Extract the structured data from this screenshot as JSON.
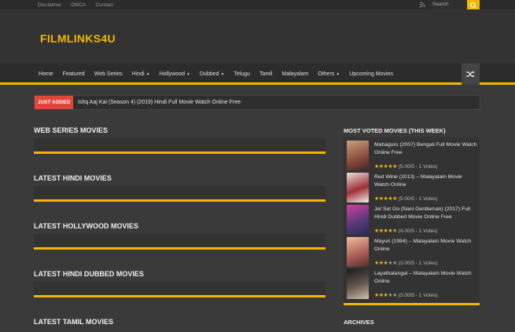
{
  "topbar": {
    "links": [
      "Disclaimer",
      "DMCA",
      "Contact"
    ],
    "search_placeholder": "Search"
  },
  "site": {
    "logo": "FILMLINKS4U"
  },
  "nav": {
    "items": [
      {
        "label": "Home",
        "dropdown": false
      },
      {
        "label": "Featured",
        "dropdown": false
      },
      {
        "label": "Web Series",
        "dropdown": false
      },
      {
        "label": "Hindi",
        "dropdown": true
      },
      {
        "label": "Hollywood",
        "dropdown": true
      },
      {
        "label": "Dubbed",
        "dropdown": true
      },
      {
        "label": "Telugu",
        "dropdown": false
      },
      {
        "label": "Tamil",
        "dropdown": false
      },
      {
        "label": "Malayalam",
        "dropdown": false
      },
      {
        "label": "Others",
        "dropdown": true
      },
      {
        "label": "Upcoming Movies",
        "dropdown": false
      }
    ]
  },
  "ticker": {
    "badge": "JUST ADDED",
    "text": "Ishq Aaj Kal (Season 4) (2019) Hindi Full Movie Watch Online Free"
  },
  "sections": [
    "WEB SERIES MOVIES",
    "LATEST HINDI MOVIES",
    "LATEST HOLLYWOOD MOVIES",
    "LATEST HINDI DUBBED MOVIES",
    "LATEST TAMIL MOVIES"
  ],
  "sidebar": {
    "title": "MOST VOTED MOVIES (THIS WEEK)",
    "movies": [
      {
        "title": "Mahaguru (2007) Bengali Full Movie Watch Online Free",
        "rating": "(5.00/5 - 1 Votes)",
        "stars": 5,
        "thumb_color": "#8a4a3a"
      },
      {
        "title": "Red Wine (2013) – Malayalam Movie Watch Online",
        "rating": "(5.00/5 - 1 Votes)",
        "stars": 5,
        "thumb_color": "#a03038"
      },
      {
        "title": "Jet Set Go (Nani Gentleman) (2017) Full Hindi Dubbed Movie Online Free",
        "rating": "(4.00/5 - 1 Votes)",
        "stars": 4,
        "thumb_color": "#5a3a78"
      },
      {
        "title": "Mayuri (1984) – Malayalam Movie Watch Online",
        "rating": "(3.00/5 - 1 Votes)",
        "stars": 3,
        "thumb_color": "#b0605a"
      },
      {
        "title": "Layathalangal – Malayalam Movie Watch Online",
        "rating": "(3.00/5 - 1 Votes)",
        "stars": 3,
        "thumb_color": "#6a5a50"
      }
    ]
  },
  "archives": "ARCHIVES",
  "colors": {
    "accent": "#f2b705",
    "badge": "#e2463a"
  }
}
